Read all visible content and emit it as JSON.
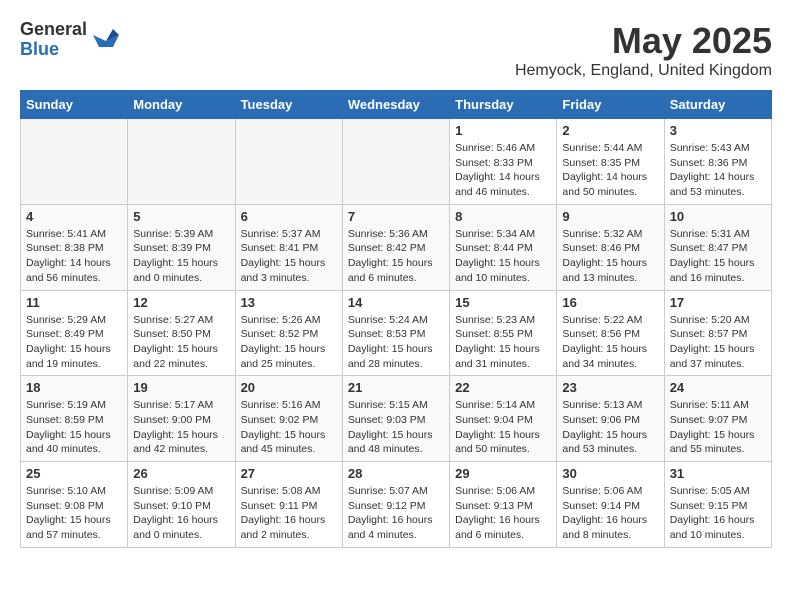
{
  "header": {
    "logo_general": "General",
    "logo_blue": "Blue",
    "month_title": "May 2025",
    "location": "Hemyock, England, United Kingdom"
  },
  "days_of_week": [
    "Sunday",
    "Monday",
    "Tuesday",
    "Wednesday",
    "Thursday",
    "Friday",
    "Saturday"
  ],
  "weeks": [
    [
      {
        "day": "",
        "info": ""
      },
      {
        "day": "",
        "info": ""
      },
      {
        "day": "",
        "info": ""
      },
      {
        "day": "",
        "info": ""
      },
      {
        "day": "1",
        "info": "Sunrise: 5:46 AM\nSunset: 8:33 PM\nDaylight: 14 hours\nand 46 minutes."
      },
      {
        "day": "2",
        "info": "Sunrise: 5:44 AM\nSunset: 8:35 PM\nDaylight: 14 hours\nand 50 minutes."
      },
      {
        "day": "3",
        "info": "Sunrise: 5:43 AM\nSunset: 8:36 PM\nDaylight: 14 hours\nand 53 minutes."
      }
    ],
    [
      {
        "day": "4",
        "info": "Sunrise: 5:41 AM\nSunset: 8:38 PM\nDaylight: 14 hours\nand 56 minutes."
      },
      {
        "day": "5",
        "info": "Sunrise: 5:39 AM\nSunset: 8:39 PM\nDaylight: 15 hours\nand 0 minutes."
      },
      {
        "day": "6",
        "info": "Sunrise: 5:37 AM\nSunset: 8:41 PM\nDaylight: 15 hours\nand 3 minutes."
      },
      {
        "day": "7",
        "info": "Sunrise: 5:36 AM\nSunset: 8:42 PM\nDaylight: 15 hours\nand 6 minutes."
      },
      {
        "day": "8",
        "info": "Sunrise: 5:34 AM\nSunset: 8:44 PM\nDaylight: 15 hours\nand 10 minutes."
      },
      {
        "day": "9",
        "info": "Sunrise: 5:32 AM\nSunset: 8:46 PM\nDaylight: 15 hours\nand 13 minutes."
      },
      {
        "day": "10",
        "info": "Sunrise: 5:31 AM\nSunset: 8:47 PM\nDaylight: 15 hours\nand 16 minutes."
      }
    ],
    [
      {
        "day": "11",
        "info": "Sunrise: 5:29 AM\nSunset: 8:49 PM\nDaylight: 15 hours\nand 19 minutes."
      },
      {
        "day": "12",
        "info": "Sunrise: 5:27 AM\nSunset: 8:50 PM\nDaylight: 15 hours\nand 22 minutes."
      },
      {
        "day": "13",
        "info": "Sunrise: 5:26 AM\nSunset: 8:52 PM\nDaylight: 15 hours\nand 25 minutes."
      },
      {
        "day": "14",
        "info": "Sunrise: 5:24 AM\nSunset: 8:53 PM\nDaylight: 15 hours\nand 28 minutes."
      },
      {
        "day": "15",
        "info": "Sunrise: 5:23 AM\nSunset: 8:55 PM\nDaylight: 15 hours\nand 31 minutes."
      },
      {
        "day": "16",
        "info": "Sunrise: 5:22 AM\nSunset: 8:56 PM\nDaylight: 15 hours\nand 34 minutes."
      },
      {
        "day": "17",
        "info": "Sunrise: 5:20 AM\nSunset: 8:57 PM\nDaylight: 15 hours\nand 37 minutes."
      }
    ],
    [
      {
        "day": "18",
        "info": "Sunrise: 5:19 AM\nSunset: 8:59 PM\nDaylight: 15 hours\nand 40 minutes."
      },
      {
        "day": "19",
        "info": "Sunrise: 5:17 AM\nSunset: 9:00 PM\nDaylight: 15 hours\nand 42 minutes."
      },
      {
        "day": "20",
        "info": "Sunrise: 5:16 AM\nSunset: 9:02 PM\nDaylight: 15 hours\nand 45 minutes."
      },
      {
        "day": "21",
        "info": "Sunrise: 5:15 AM\nSunset: 9:03 PM\nDaylight: 15 hours\nand 48 minutes."
      },
      {
        "day": "22",
        "info": "Sunrise: 5:14 AM\nSunset: 9:04 PM\nDaylight: 15 hours\nand 50 minutes."
      },
      {
        "day": "23",
        "info": "Sunrise: 5:13 AM\nSunset: 9:06 PM\nDaylight: 15 hours\nand 53 minutes."
      },
      {
        "day": "24",
        "info": "Sunrise: 5:11 AM\nSunset: 9:07 PM\nDaylight: 15 hours\nand 55 minutes."
      }
    ],
    [
      {
        "day": "25",
        "info": "Sunrise: 5:10 AM\nSunset: 9:08 PM\nDaylight: 15 hours\nand 57 minutes."
      },
      {
        "day": "26",
        "info": "Sunrise: 5:09 AM\nSunset: 9:10 PM\nDaylight: 16 hours\nand 0 minutes."
      },
      {
        "day": "27",
        "info": "Sunrise: 5:08 AM\nSunset: 9:11 PM\nDaylight: 16 hours\nand 2 minutes."
      },
      {
        "day": "28",
        "info": "Sunrise: 5:07 AM\nSunset: 9:12 PM\nDaylight: 16 hours\nand 4 minutes."
      },
      {
        "day": "29",
        "info": "Sunrise: 5:06 AM\nSunset: 9:13 PM\nDaylight: 16 hours\nand 6 minutes."
      },
      {
        "day": "30",
        "info": "Sunrise: 5:06 AM\nSunset: 9:14 PM\nDaylight: 16 hours\nand 8 minutes."
      },
      {
        "day": "31",
        "info": "Sunrise: 5:05 AM\nSunset: 9:15 PM\nDaylight: 16 hours\nand 10 minutes."
      }
    ]
  ]
}
